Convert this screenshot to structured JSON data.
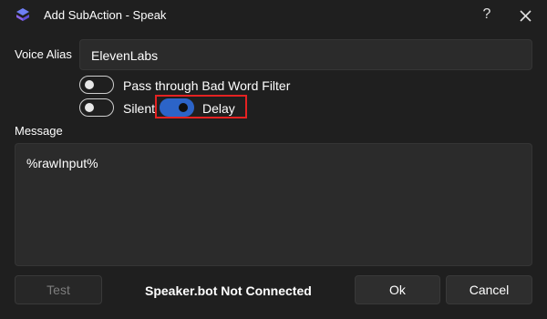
{
  "window": {
    "title": "Add SubAction - Speak",
    "help_glyph": "?",
    "logo_icon": "streamerbot-logo-icon",
    "close_icon": "close-icon"
  },
  "form": {
    "voice_alias_label": "Voice Alias",
    "voice_alias_value": "ElevenLabs",
    "bad_word_filter_label": "Pass through Bad Word Filter",
    "bad_word_filter_enabled": false,
    "silent_label": "Silent",
    "silent_enabled": false,
    "delay_label": "Delay",
    "delay_enabled": true,
    "message_label": "Message",
    "message_value": "%rawInput%"
  },
  "footer": {
    "test_label": "Test",
    "status_text": "Speaker.bot Not Connected",
    "ok_label": "Ok",
    "cancel_label": "Cancel"
  },
  "colors": {
    "background": "#1f1f1f",
    "field": "#2b2b2b",
    "toggle_on": "#2c64c8",
    "highlight": "#e52222"
  }
}
